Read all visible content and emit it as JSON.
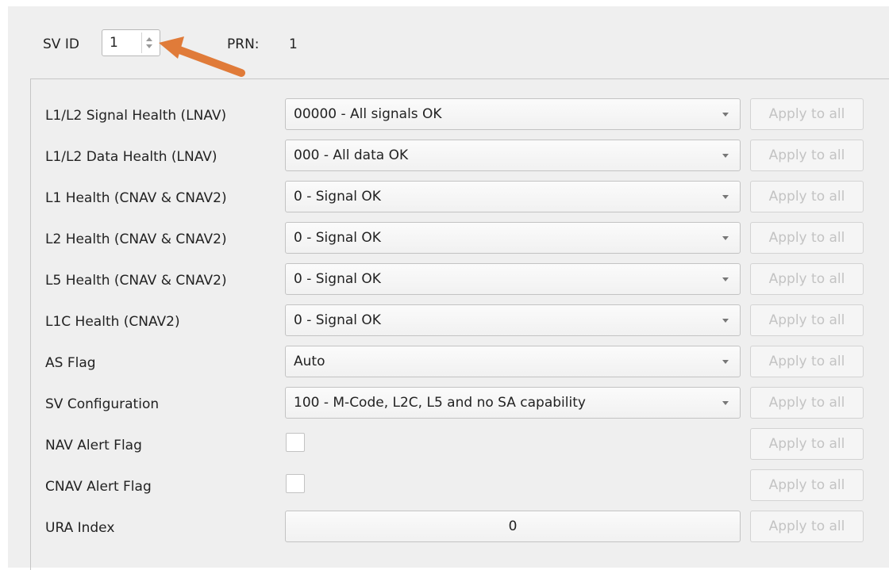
{
  "header": {
    "sv_id_label": "SV ID",
    "sv_id_value": "1",
    "prn_label": "PRN:",
    "prn_value": "1"
  },
  "apply_label": "Apply to all",
  "rows": [
    {
      "label": "L1/L2 Signal Health (LNAV)",
      "type": "select",
      "value": "00000 - All signals OK"
    },
    {
      "label": "L1/L2 Data Health (LNAV)",
      "type": "select",
      "value": "000 - All data OK"
    },
    {
      "label": "L1 Health (CNAV & CNAV2)",
      "type": "select",
      "value": "0 - Signal OK"
    },
    {
      "label": "L2 Health (CNAV & CNAV2)",
      "type": "select",
      "value": "0 - Signal OK"
    },
    {
      "label": "L5 Health (CNAV & CNAV2)",
      "type": "select",
      "value": "0 - Signal OK"
    },
    {
      "label": "L1C Health (CNAV2)",
      "type": "select",
      "value": "0 - Signal OK"
    },
    {
      "label": "AS Flag",
      "type": "select",
      "value": "Auto"
    },
    {
      "label": "SV Configuration",
      "type": "select",
      "value": "100 - M-Code, L2C, L5 and no SA capability"
    },
    {
      "label": "NAV Alert Flag",
      "type": "checkbox",
      "checked": false
    },
    {
      "label": "CNAV Alert Flag",
      "type": "checkbox",
      "checked": false
    },
    {
      "label": "URA Index",
      "type": "number",
      "value": "0"
    }
  ],
  "colors": {
    "annotation_arrow": "#e07b39",
    "panel_bg": "#efefef",
    "disabled_text": "#c3c3c3"
  }
}
